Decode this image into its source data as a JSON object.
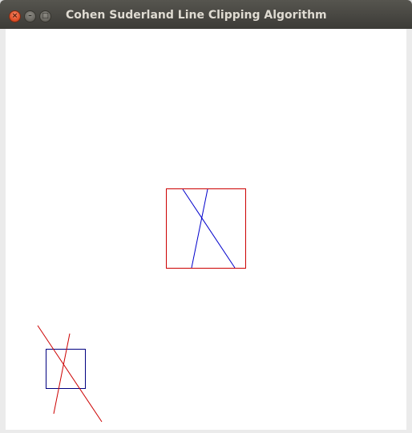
{
  "window": {
    "title": "Cohen Suderland Line Clipping Algorithm"
  },
  "titlebar_buttons": {
    "close_glyph": "×",
    "minimize_glyph": "–",
    "maximize_glyph": "□"
  },
  "colors": {
    "clip_window_main": "#cc0000",
    "clipped_lines": "#0000cc",
    "clip_window_small": "#000080",
    "original_lines": "#cc0000",
    "titlebar": "#3c3b37",
    "close_button": "#e0512a"
  }
}
